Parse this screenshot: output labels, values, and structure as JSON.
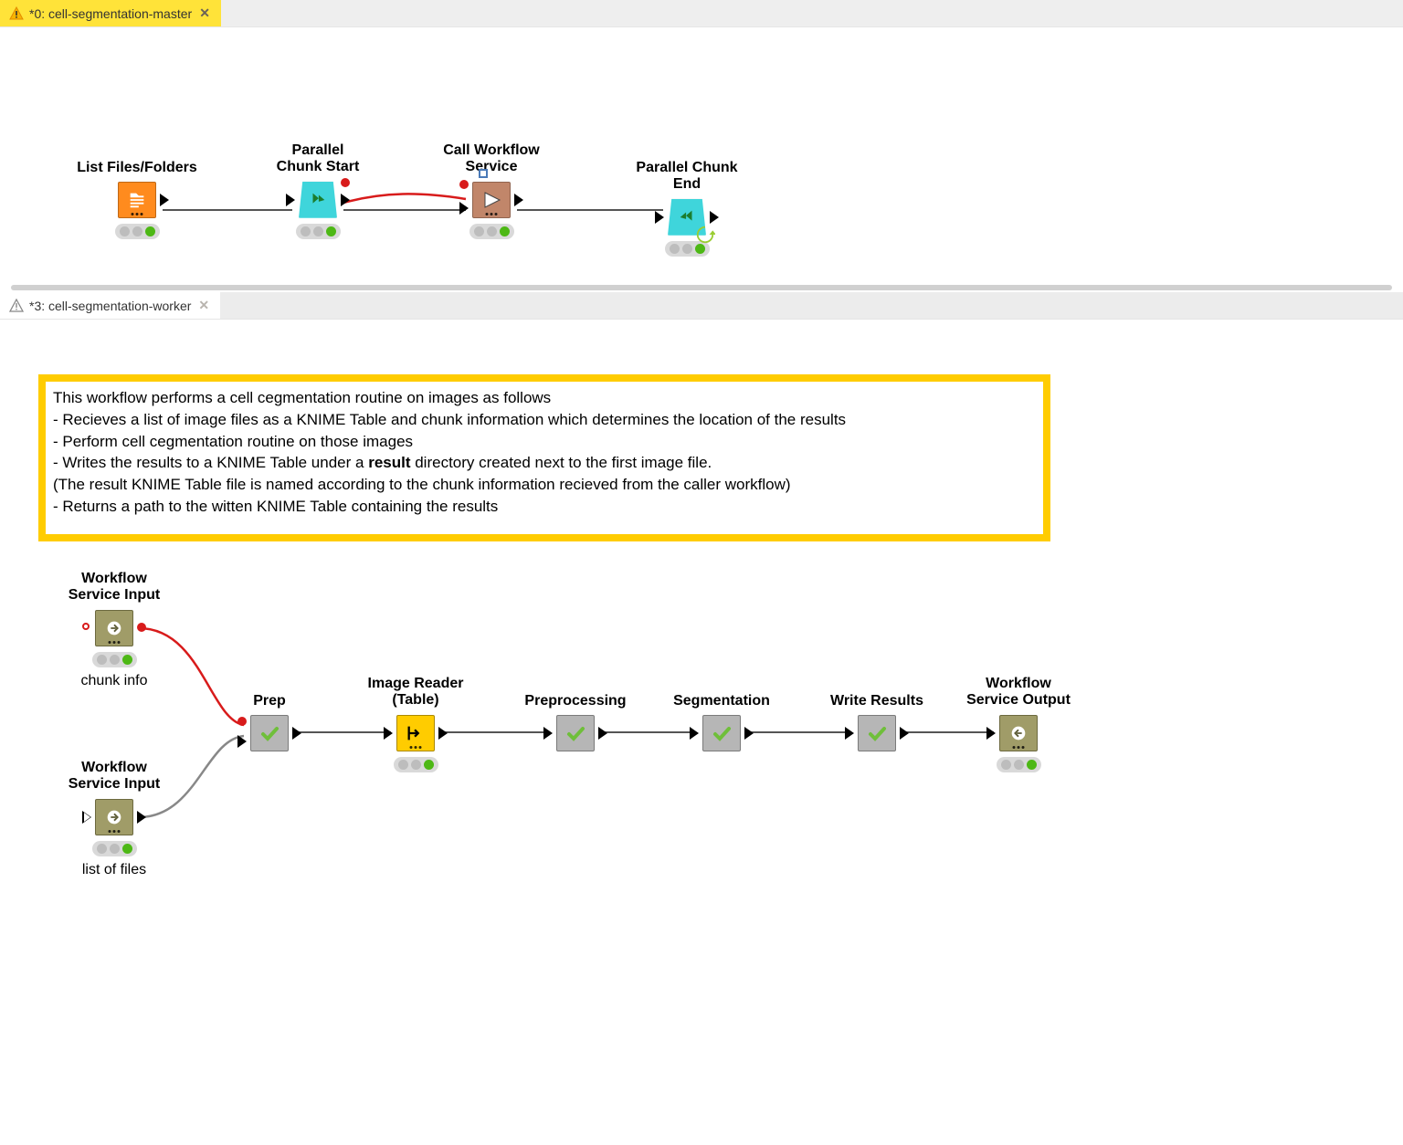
{
  "tabs": {
    "top": {
      "title": "*0: cell-segmentation-master"
    },
    "bottom": {
      "title": "*3: cell-segmentation-worker"
    }
  },
  "top_nodes": {
    "n1": {
      "label": "List Files/Folders"
    },
    "n2": {
      "label": "Parallel\nChunk Start"
    },
    "n3": {
      "label": "Call Workflow\nService"
    },
    "n4": {
      "label": "Parallel Chunk End"
    }
  },
  "annotation": {
    "l1": "This workflow performs a cell cegmentation routine on images as follows",
    "l2": "- Recieves a list of image files as a KNIME Table and chunk information which determines the location of the results",
    "l3": "- Perform cell cegmentation routine on those images",
    "l4a": "- Writes the results to a KNIME Table under a ",
    "l4b": "result",
    "l4c": " directory created  next to the first image file.",
    "l5": "  (The result KNIME Table file is named according to the chunk information recieved from the caller workflow)",
    "l6": "- Returns a path to the witten KNIME Table containing the results"
  },
  "bottom_nodes": {
    "b1": {
      "label": "Workflow\nService Input",
      "sub": "chunk info"
    },
    "b2": {
      "label": "Workflow\nService Input",
      "sub": "list of files"
    },
    "b3": {
      "label": "Prep"
    },
    "b4": {
      "label": "Image Reader\n(Table)"
    },
    "b5": {
      "label": "Preprocessing"
    },
    "b6": {
      "label": "Segmentation"
    },
    "b7": {
      "label": "Write Results"
    },
    "b8": {
      "label": "Workflow\nService Output"
    }
  }
}
